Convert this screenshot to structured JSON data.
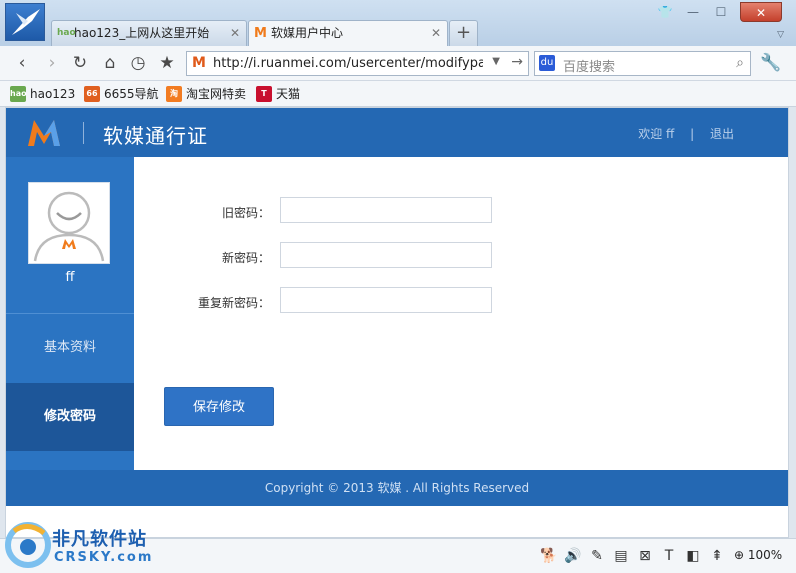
{
  "browser": {
    "tabs": [
      {
        "title": "hao123_上网从这里开始",
        "favicon": "hao-icon"
      },
      {
        "title": "软媒用户中心",
        "favicon": "m-icon"
      }
    ],
    "address": "http://i.ruanmei.com/usercenter/modifypass",
    "search_placeholder": "百度搜索",
    "bookmarks": [
      {
        "label": "hao123",
        "color": "#6aa84f"
      },
      {
        "label": "6655导航",
        "color": "#e06020"
      },
      {
        "label": "淘宝网特卖",
        "color": "#f27c22"
      },
      {
        "label": "天猫",
        "color": "#c8102e"
      }
    ],
    "zoom": "100%"
  },
  "site": {
    "brand_title": "软媒通行证",
    "welcome": "欢迎 ff",
    "separator": "|",
    "logout": "退出",
    "username": "ff",
    "menu": [
      {
        "label": "基本资料",
        "active": false
      },
      {
        "label": "修改密码",
        "active": true
      }
    ],
    "form": {
      "old_password_label": "旧密码：",
      "new_password_label": "新密码：",
      "repeat_password_label": "重复新密码：",
      "old_password_value": "",
      "new_password_value": "",
      "repeat_password_value": "",
      "save_button": "保存修改"
    },
    "footer": "Copyright © 2013 软媒 . All Rights Reserved",
    "colors": {
      "header": "#2468b3",
      "sidebar": "#2b74c2",
      "sidebar_active": "#1d5699",
      "button": "#2f73c6",
      "brand_orange": "#f07b1c"
    }
  },
  "watermark": {
    "title": "非凡软件站",
    "sub": "CRSKY.com"
  }
}
